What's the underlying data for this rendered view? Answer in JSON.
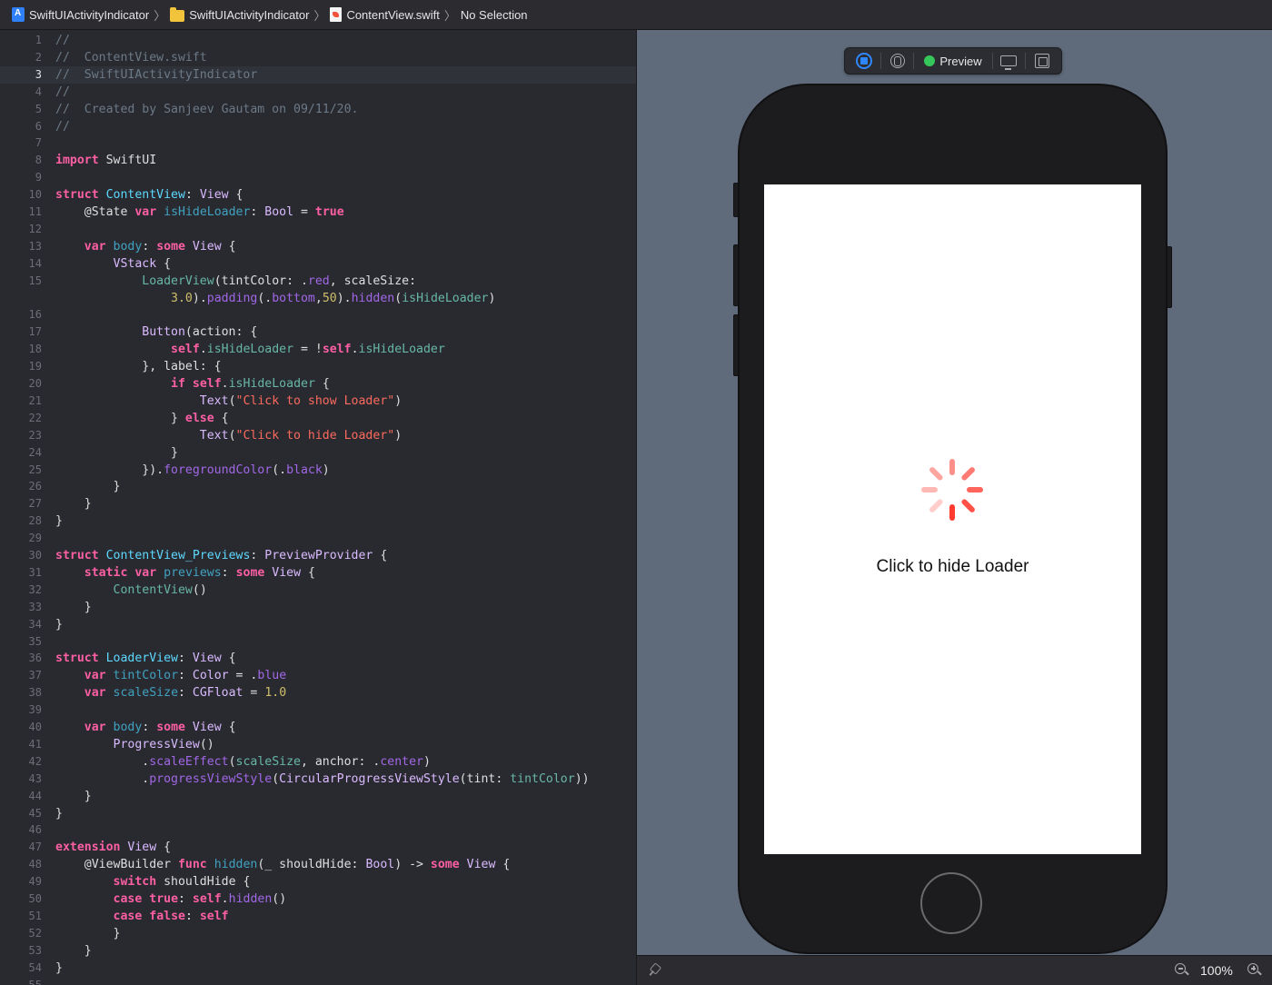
{
  "jumpbar": {
    "project": "SwiftUIActivityIndicator",
    "folder": "SwiftUIActivityIndicator",
    "file": "ContentView.swift",
    "selection": "No Selection",
    "separator": "〉"
  },
  "editor": {
    "current_line": 3,
    "lines": [
      {
        "n": "1",
        "tokens": [
          [
            "c",
            "//"
          ]
        ]
      },
      {
        "n": "2",
        "tokens": [
          [
            "c",
            "//  ContentView.swift"
          ]
        ]
      },
      {
        "n": "3",
        "tokens": [
          [
            "c",
            "//  SwiftUIActivityIndicator"
          ]
        ]
      },
      {
        "n": "4",
        "tokens": [
          [
            "c",
            "//"
          ]
        ]
      },
      {
        "n": "5",
        "tokens": [
          [
            "c",
            "//  Created by Sanjeev Gautam on 09/11/20."
          ]
        ]
      },
      {
        "n": "6",
        "tokens": [
          [
            "c",
            "//"
          ]
        ]
      },
      {
        "n": "7",
        "tokens": []
      },
      {
        "n": "8",
        "tokens": [
          [
            "k",
            "import"
          ],
          [
            "",
            " SwiftUI"
          ]
        ]
      },
      {
        "n": "9",
        "tokens": []
      },
      {
        "n": "10",
        "tokens": [
          [
            "k",
            "struct"
          ],
          [
            "",
            " "
          ],
          [
            "d",
            "ContentView"
          ],
          [
            "",
            ": "
          ],
          [
            "tp",
            "View"
          ],
          [
            "",
            " {"
          ]
        ]
      },
      {
        "n": "11",
        "tokens": [
          [
            "",
            "    @State "
          ],
          [
            "k",
            "var"
          ],
          [
            "",
            " "
          ],
          [
            "p",
            "isHideLoader"
          ],
          [
            "",
            ": "
          ],
          [
            "tp",
            "Bool"
          ],
          [
            "",
            " = "
          ],
          [
            "k",
            "true"
          ]
        ]
      },
      {
        "n": "12",
        "tokens": []
      },
      {
        "n": "13",
        "tokens": [
          [
            "",
            "    "
          ],
          [
            "k",
            "var"
          ],
          [
            "",
            " "
          ],
          [
            "p",
            "body"
          ],
          [
            "",
            ": "
          ],
          [
            "k",
            "some"
          ],
          [
            "",
            " "
          ],
          [
            "tp",
            "View"
          ],
          [
            "",
            " {"
          ]
        ]
      },
      {
        "n": "14",
        "tokens": [
          [
            "",
            "        "
          ],
          [
            "tp",
            "VStack"
          ],
          [
            "",
            " {"
          ]
        ]
      },
      {
        "n": "15",
        "tokens": [
          [
            "",
            "            "
          ],
          [
            "o",
            "LoaderView"
          ],
          [
            "",
            "(tintColor: ."
          ],
          [
            "m",
            "red"
          ],
          [
            "",
            ", scaleSize:"
          ]
        ]
      },
      {
        "n": "",
        "tokens": [
          [
            "",
            "                "
          ],
          [
            "n",
            "3.0"
          ],
          [
            "",
            ")."
          ],
          [
            "m",
            "padding"
          ],
          [
            "",
            "(."
          ],
          [
            "m",
            "bottom"
          ],
          [
            "",
            ","
          ],
          [
            "n",
            "50"
          ],
          [
            "",
            ")."
          ],
          [
            "m",
            "hidden"
          ],
          [
            "",
            "("
          ],
          [
            "o",
            "isHideLoader"
          ],
          [
            "",
            ")"
          ]
        ]
      },
      {
        "n": "16",
        "tokens": []
      },
      {
        "n": "17",
        "tokens": [
          [
            "",
            "            "
          ],
          [
            "tp",
            "Button"
          ],
          [
            "",
            "(action: {"
          ]
        ]
      },
      {
        "n": "18",
        "tokens": [
          [
            "",
            "                "
          ],
          [
            "k",
            "self"
          ],
          [
            "",
            "."
          ],
          [
            "o",
            "isHideLoader"
          ],
          [
            "",
            " = !"
          ],
          [
            "k",
            "self"
          ],
          [
            "",
            "."
          ],
          [
            "o",
            "isHideLoader"
          ]
        ]
      },
      {
        "n": "19",
        "tokens": [
          [
            "",
            "            }, label: {"
          ]
        ]
      },
      {
        "n": "20",
        "tokens": [
          [
            "",
            "                "
          ],
          [
            "k",
            "if"
          ],
          [
            "",
            " "
          ],
          [
            "k",
            "self"
          ],
          [
            "",
            "."
          ],
          [
            "o",
            "isHideLoader"
          ],
          [
            "",
            " {"
          ]
        ]
      },
      {
        "n": "21",
        "tokens": [
          [
            "",
            "                    "
          ],
          [
            "tp",
            "Text"
          ],
          [
            "",
            "("
          ],
          [
            "s",
            "\"Click to show Loader\""
          ],
          [
            "",
            ")"
          ]
        ]
      },
      {
        "n": "22",
        "tokens": [
          [
            "",
            "                } "
          ],
          [
            "k",
            "else"
          ],
          [
            "",
            " {"
          ]
        ]
      },
      {
        "n": "23",
        "tokens": [
          [
            "",
            "                    "
          ],
          [
            "tp",
            "Text"
          ],
          [
            "",
            "("
          ],
          [
            "s",
            "\"Click to hide Loader\""
          ],
          [
            "",
            ")"
          ]
        ]
      },
      {
        "n": "24",
        "tokens": [
          [
            "",
            "                }"
          ]
        ]
      },
      {
        "n": "25",
        "tokens": [
          [
            "",
            "            })."
          ],
          [
            "m",
            "foregroundColor"
          ],
          [
            "",
            "(."
          ],
          [
            "m",
            "black"
          ],
          [
            "",
            ")"
          ]
        ]
      },
      {
        "n": "26",
        "tokens": [
          [
            "",
            "        }"
          ]
        ]
      },
      {
        "n": "27",
        "tokens": [
          [
            "",
            "    }"
          ]
        ]
      },
      {
        "n": "28",
        "tokens": [
          [
            "",
            "}"
          ]
        ]
      },
      {
        "n": "29",
        "tokens": []
      },
      {
        "n": "30",
        "tokens": [
          [
            "k",
            "struct"
          ],
          [
            "",
            " "
          ],
          [
            "d",
            "ContentView_Previews"
          ],
          [
            "",
            ": "
          ],
          [
            "tp",
            "PreviewProvider"
          ],
          [
            "",
            " {"
          ]
        ]
      },
      {
        "n": "31",
        "tokens": [
          [
            "",
            "    "
          ],
          [
            "k",
            "static"
          ],
          [
            "",
            " "
          ],
          [
            "k",
            "var"
          ],
          [
            "",
            " "
          ],
          [
            "p",
            "previews"
          ],
          [
            "",
            ": "
          ],
          [
            "k",
            "some"
          ],
          [
            "",
            " "
          ],
          [
            "tp",
            "View"
          ],
          [
            "",
            " {"
          ]
        ]
      },
      {
        "n": "32",
        "tokens": [
          [
            "",
            "        "
          ],
          [
            "o",
            "ContentView"
          ],
          [
            "",
            "()"
          ]
        ]
      },
      {
        "n": "33",
        "tokens": [
          [
            "",
            "    }"
          ]
        ]
      },
      {
        "n": "34",
        "tokens": [
          [
            "",
            "}"
          ]
        ]
      },
      {
        "n": "35",
        "tokens": []
      },
      {
        "n": "36",
        "tokens": [
          [
            "k",
            "struct"
          ],
          [
            "",
            " "
          ],
          [
            "d",
            "LoaderView"
          ],
          [
            "",
            ": "
          ],
          [
            "tp",
            "View"
          ],
          [
            "",
            " {"
          ]
        ]
      },
      {
        "n": "37",
        "tokens": [
          [
            "",
            "    "
          ],
          [
            "k",
            "var"
          ],
          [
            "",
            " "
          ],
          [
            "p",
            "tintColor"
          ],
          [
            "",
            ": "
          ],
          [
            "tp",
            "Color"
          ],
          [
            "",
            " = ."
          ],
          [
            "m",
            "blue"
          ]
        ]
      },
      {
        "n": "38",
        "tokens": [
          [
            "",
            "    "
          ],
          [
            "k",
            "var"
          ],
          [
            "",
            " "
          ],
          [
            "p",
            "scaleSize"
          ],
          [
            "",
            ": "
          ],
          [
            "tp",
            "CGFloat"
          ],
          [
            "",
            " = "
          ],
          [
            "n",
            "1.0"
          ]
        ]
      },
      {
        "n": "39",
        "tokens": []
      },
      {
        "n": "40",
        "tokens": [
          [
            "",
            "    "
          ],
          [
            "k",
            "var"
          ],
          [
            "",
            " "
          ],
          [
            "p",
            "body"
          ],
          [
            "",
            ": "
          ],
          [
            "k",
            "some"
          ],
          [
            "",
            " "
          ],
          [
            "tp",
            "View"
          ],
          [
            "",
            " {"
          ]
        ]
      },
      {
        "n": "41",
        "tokens": [
          [
            "",
            "        "
          ],
          [
            "tp",
            "ProgressView"
          ],
          [
            "",
            "()"
          ]
        ]
      },
      {
        "n": "42",
        "tokens": [
          [
            "",
            "            ."
          ],
          [
            "m",
            "scaleEffect"
          ],
          [
            "",
            "("
          ],
          [
            "o",
            "scaleSize"
          ],
          [
            "",
            ", anchor: ."
          ],
          [
            "m",
            "center"
          ],
          [
            "",
            ")"
          ]
        ]
      },
      {
        "n": "43",
        "tokens": [
          [
            "",
            "            ."
          ],
          [
            "m",
            "progressViewStyle"
          ],
          [
            "",
            "("
          ],
          [
            "tp",
            "CircularProgressViewStyle"
          ],
          [
            "",
            "(tint: "
          ],
          [
            "o",
            "tintColor"
          ],
          [
            "",
            "))"
          ]
        ]
      },
      {
        "n": "44",
        "tokens": [
          [
            "",
            "    }"
          ]
        ]
      },
      {
        "n": "45",
        "tokens": [
          [
            "",
            "}"
          ]
        ]
      },
      {
        "n": "46",
        "tokens": []
      },
      {
        "n": "47",
        "tokens": [
          [
            "k",
            "extension"
          ],
          [
            "",
            " "
          ],
          [
            "tp",
            "View"
          ],
          [
            "",
            " {"
          ]
        ]
      },
      {
        "n": "48",
        "tokens": [
          [
            "",
            "    @ViewBuilder "
          ],
          [
            "k",
            "func"
          ],
          [
            "",
            " "
          ],
          [
            "p",
            "hidden"
          ],
          [
            "",
            "(_ shouldHide: "
          ],
          [
            "tp",
            "Bool"
          ],
          [
            "",
            ") -> "
          ],
          [
            "k",
            "some"
          ],
          [
            "",
            " "
          ],
          [
            "tp",
            "View"
          ],
          [
            "",
            " {"
          ]
        ]
      },
      {
        "n": "49",
        "tokens": [
          [
            "",
            "        "
          ],
          [
            "k",
            "switch"
          ],
          [
            "",
            " shouldHide {"
          ]
        ]
      },
      {
        "n": "50",
        "tokens": [
          [
            "",
            "        "
          ],
          [
            "k",
            "case"
          ],
          [
            "",
            " "
          ],
          [
            "k",
            "true"
          ],
          [
            "",
            ": "
          ],
          [
            "k",
            "self"
          ],
          [
            "",
            "."
          ],
          [
            "m",
            "hidden"
          ],
          [
            "",
            "()"
          ]
        ]
      },
      {
        "n": "51",
        "tokens": [
          [
            "",
            "        "
          ],
          [
            "k",
            "case"
          ],
          [
            "",
            " "
          ],
          [
            "k",
            "false"
          ],
          [
            "",
            ": "
          ],
          [
            "k",
            "self"
          ]
        ]
      },
      {
        "n": "52",
        "tokens": [
          [
            "",
            "        }"
          ]
        ]
      },
      {
        "n": "53",
        "tokens": [
          [
            "",
            "    }"
          ]
        ]
      },
      {
        "n": "54",
        "tokens": [
          [
            "",
            "}"
          ]
        ]
      },
      {
        "n": "55",
        "tokens": []
      }
    ]
  },
  "canvas": {
    "toolbar": {
      "live_icon": "live-preview-icon",
      "pin_icon": "pin-preview-icon",
      "preview_label": "Preview",
      "status_color": "#35c759",
      "device_icon": "device-settings-icon",
      "duplicate_icon": "duplicate-preview-icon"
    },
    "app": {
      "spinner_color": "#ff3b30",
      "button_label": "Click to hide Loader"
    },
    "footer": {
      "zoom": "100%"
    }
  }
}
